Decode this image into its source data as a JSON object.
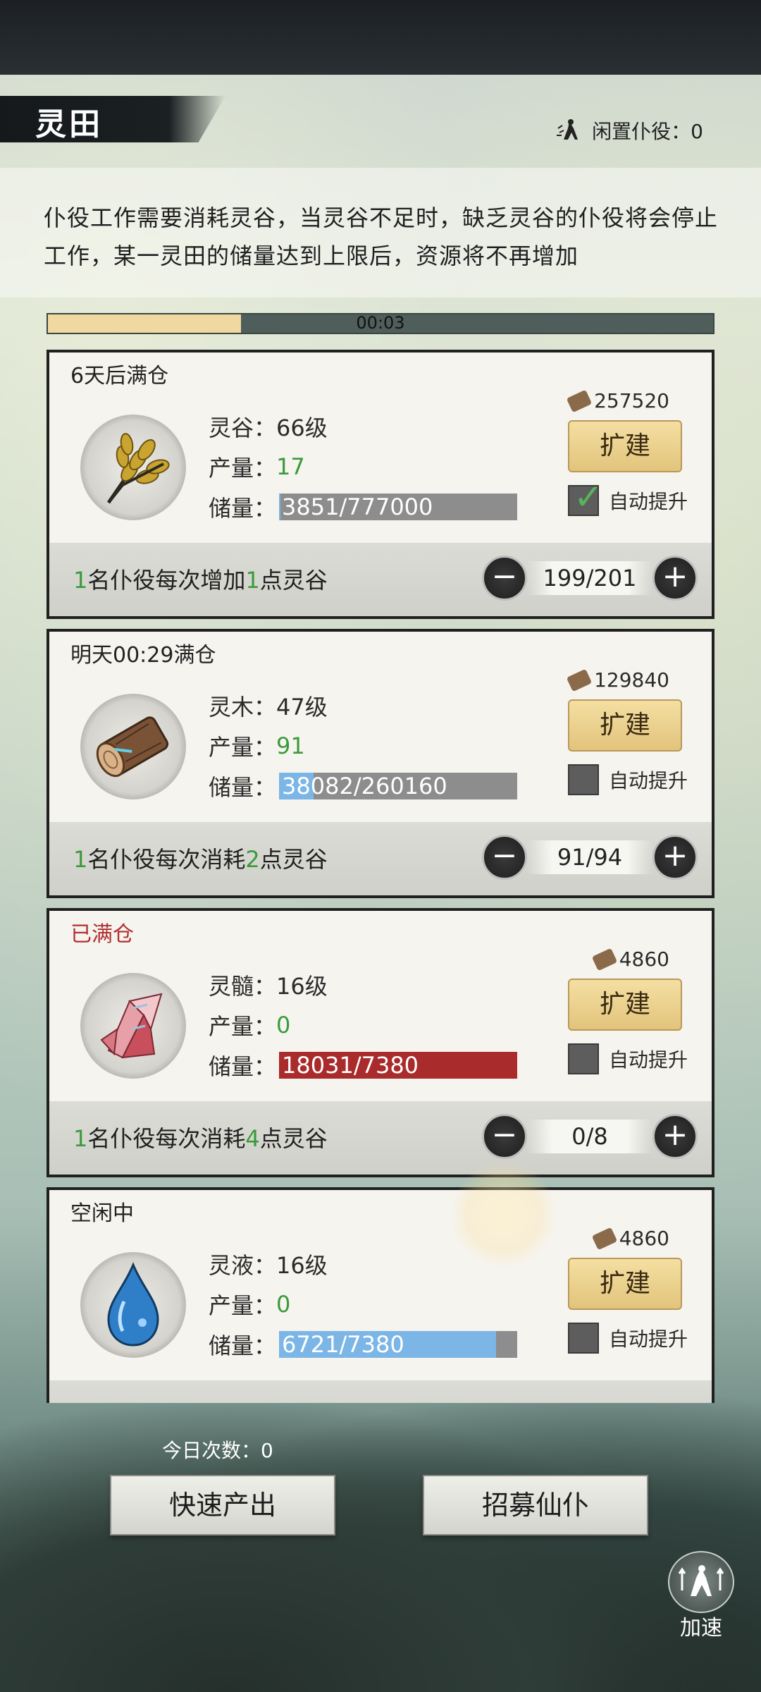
{
  "header": {
    "title": "灵田",
    "idle_label": "闲置仆役：",
    "idle_count": "0"
  },
  "description": "仆役工作需要消耗灵谷，当灵谷不足时，缺乏灵谷的仆役将会停止工作，某一灵田的储量达到上限后，资源将不再增加",
  "timer": {
    "text": "00:03",
    "progress": 0.29
  },
  "fields": [
    {
      "status": "6天后满仓",
      "status_full": false,
      "icon": "wheat-icon",
      "name_label": "灵谷：",
      "level": "66级",
      "output_label": "产量：",
      "output": "17",
      "storage_label": "储量：",
      "storage": "3851/777000",
      "storage_fill": 0.005,
      "storage_color": "#7bb6e6",
      "cost": "257520",
      "expand": "扩建",
      "auto_label": "自动提升",
      "auto_checked": true,
      "worker_pre": "1",
      "worker_mid": "名仆役每次增加",
      "worker_amt": "1",
      "worker_post": "点灵谷",
      "workers": "199/201"
    },
    {
      "status": "明天00:29满仓",
      "status_full": false,
      "icon": "wood-log-icon",
      "name_label": "灵木：",
      "level": "47级",
      "output_label": "产量：",
      "output": "91",
      "storage_label": "储量：",
      "storage": "38082/260160",
      "storage_fill": 0.146,
      "storage_color": "#7bb6e6",
      "cost": "129840",
      "expand": "扩建",
      "auto_label": "自动提升",
      "auto_checked": false,
      "worker_pre": "1",
      "worker_mid": "名仆役每次消耗",
      "worker_amt": "2",
      "worker_post": "点灵谷",
      "workers": "91/94"
    },
    {
      "status": "已满仓",
      "status_full": true,
      "icon": "crystal-icon",
      "name_label": "灵髓：",
      "level": "16级",
      "output_label": "产量：",
      "output": "0",
      "storage_label": "储量：",
      "storage": "18031/7380",
      "storage_fill": 1.0,
      "storage_color": "#a92b2b",
      "cost": "4860",
      "expand": "扩建",
      "auto_label": "自动提升",
      "auto_checked": false,
      "worker_pre": "1",
      "worker_mid": "名仆役每次消耗",
      "worker_amt": "4",
      "worker_post": "点灵谷",
      "workers": "0/8"
    },
    {
      "status": "空闲中",
      "status_full": false,
      "icon": "water-drop-icon",
      "name_label": "灵液：",
      "level": "16级",
      "output_label": "产量：",
      "output": "0",
      "storage_label": "储量：",
      "storage": "6721/7380",
      "storage_fill": 0.911,
      "storage_color": "#7bb6e6",
      "cost": "4860",
      "expand": "扩建",
      "auto_label": "自动提升",
      "auto_checked": false,
      "worker_pre": "",
      "worker_mid": "",
      "worker_amt": "",
      "worker_post": "",
      "workers": ""
    }
  ],
  "footer": {
    "today_label": "今日次数：",
    "today_count": "0",
    "quick_output": "快速产出",
    "recruit": "招募仙仆",
    "speed_up": "加速"
  }
}
